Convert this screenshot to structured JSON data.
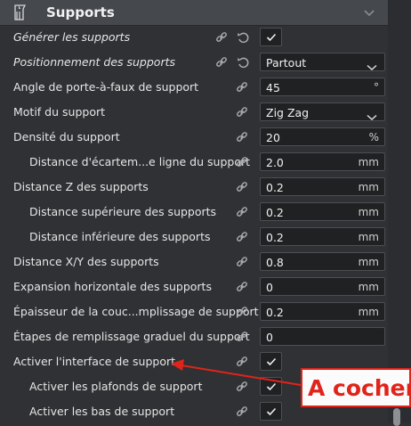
{
  "section": {
    "title": "Supports",
    "icon": "support-structure-icon",
    "collapse_icon": "chevron-down-icon"
  },
  "rows": [
    {
      "label": "Générer les supports",
      "italic": true,
      "control": "check"
    },
    {
      "label": "Positionnement des supports",
      "italic": true,
      "control": "dropdown",
      "value": "Partout"
    },
    {
      "label": "Angle de porte-à-faux de support",
      "control": "field",
      "value": "45",
      "unit": "°"
    },
    {
      "label": "Motif du support",
      "control": "dropdown",
      "value": "Zig Zag"
    },
    {
      "label": "Densité du support",
      "control": "field",
      "value": "20",
      "unit": "%"
    },
    {
      "label": "Distance d'écartem...e ligne du support",
      "control": "field",
      "value": "2.0",
      "unit": "mm"
    },
    {
      "label": "Distance Z des supports",
      "control": "field",
      "value": "0.2",
      "unit": "mm"
    },
    {
      "label": "Distance supérieure des supports",
      "control": "field",
      "value": "0.2",
      "unit": "mm"
    },
    {
      "label": "Distance inférieure des supports",
      "control": "field",
      "value": "0.2",
      "unit": "mm"
    },
    {
      "label": "Distance X/Y des supports",
      "control": "field",
      "value": "0.8",
      "unit": "mm"
    },
    {
      "label": "Expansion horizontale des supports",
      "control": "field",
      "value": "0",
      "unit": "mm"
    },
    {
      "label": "Épaisseur de la couc...mplissage de support",
      "control": "field",
      "value": "0.2",
      "unit": "mm"
    },
    {
      "label": "Étapes de remplissage graduel du support",
      "control": "field",
      "value": "0",
      "unit": ""
    },
    {
      "label": "Activer l'interface de support",
      "control": "check"
    },
    {
      "label": "Activer les plafonds de support",
      "control": "check"
    },
    {
      "label": "Activer les bas de support",
      "control": "check"
    }
  ],
  "annotation": {
    "text": "A cocher"
  },
  "colors": {
    "annotation": "#e0241b",
    "panel": "#2f3134",
    "header": "#45484c"
  }
}
